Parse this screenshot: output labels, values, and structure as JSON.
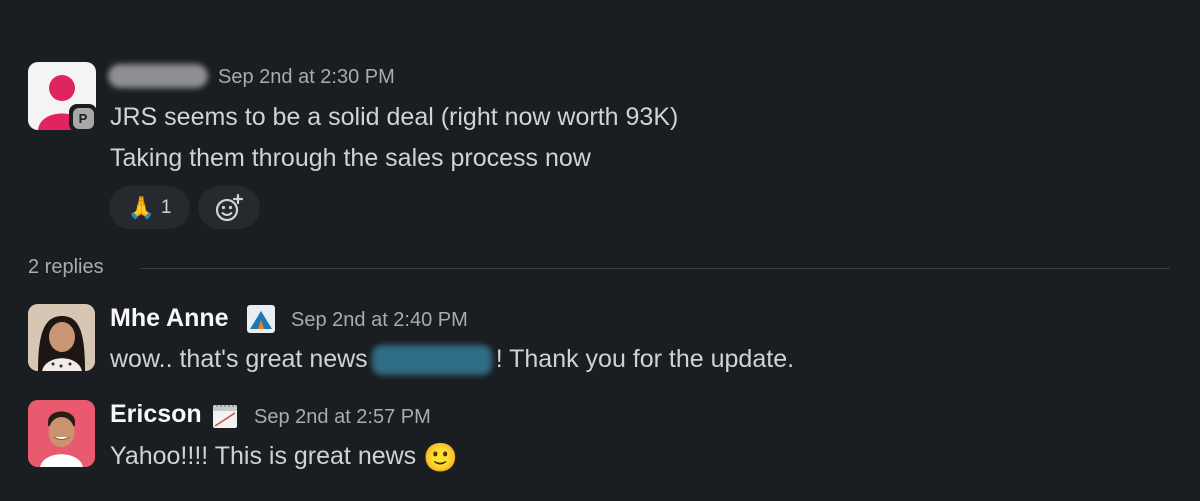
{
  "parent_message": {
    "timestamp": "Sep 2nd at 2:30 PM",
    "presence_letter": "P",
    "lines": [
      "JRS seems to be a solid deal (right now worth 93K)",
      "Taking them through the sales process now"
    ],
    "reaction": {
      "emoji": "🙏",
      "count": "1"
    },
    "add_reaction_icon": "add-emoji-icon"
  },
  "replies": {
    "label": "2 replies",
    "items": [
      {
        "name": "Mhe Anne",
        "status_icon": "tent-icon",
        "timestamp": "Sep 2nd at 2:40 PM",
        "text_before": "wow.. that's great news",
        "text_after": "! Thank you for the update."
      },
      {
        "name": "Ericson",
        "status_icon": "calendar-icon",
        "timestamp": "Sep 2nd at 2:57 PM",
        "text": "Yahoo!!!! This is great news",
        "emoji": "🙂"
      }
    ]
  }
}
